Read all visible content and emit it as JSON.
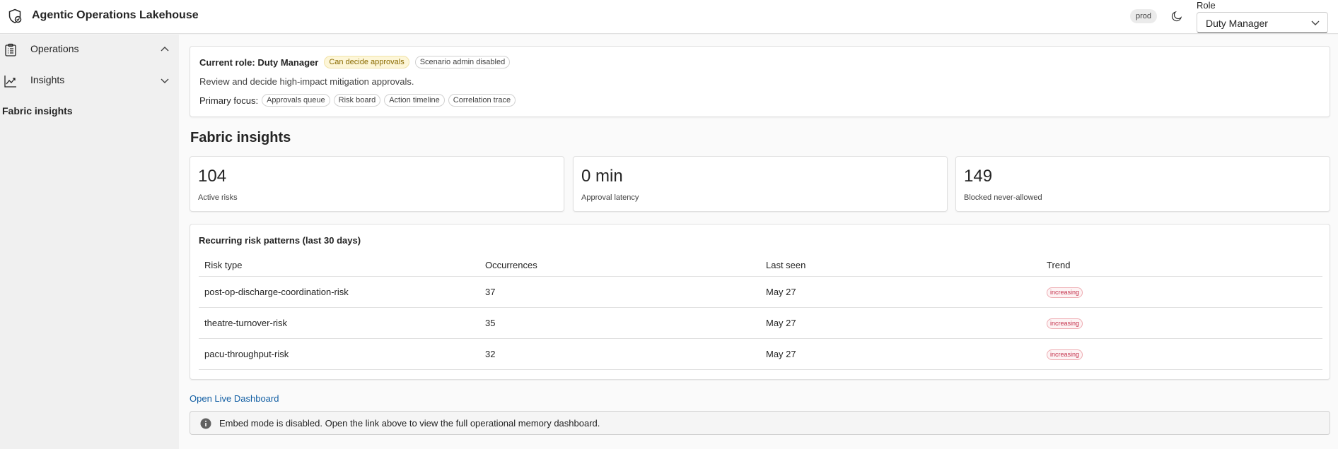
{
  "header": {
    "app_title": "Agentic Operations Lakehouse",
    "env_badge": "prod",
    "role_label": "Role",
    "role_value": "Duty Manager"
  },
  "sidebar": {
    "items": [
      {
        "label": "Operations",
        "icon": "clipboard-icon",
        "expanded": true
      },
      {
        "label": "Insights",
        "icon": "chart-line-icon",
        "expanded": false
      }
    ],
    "active_sub": "Fabric insights"
  },
  "role_card": {
    "current_role": "Current role: Duty Manager",
    "chips": [
      "Can decide approvals",
      "Scenario admin disabled"
    ],
    "description": "Review and decide high-impact mitigation approvals.",
    "focus_label": "Primary focus:",
    "focus_chips": [
      "Approvals queue",
      "Risk board",
      "Action timeline",
      "Correlation trace"
    ]
  },
  "page_title": "Fabric insights",
  "kpis": [
    {
      "value": "104",
      "label": "Active risks"
    },
    {
      "value": "0 min",
      "label": "Approval latency"
    },
    {
      "value": "149",
      "label": "Blocked never-allowed"
    }
  ],
  "patterns": {
    "title": "Recurring risk patterns (last 30 days)",
    "columns": [
      "Risk type",
      "Occurrences",
      "Last seen",
      "Trend"
    ],
    "rows": [
      {
        "risk": "post-op-discharge-coordination-risk",
        "occurrences": "37",
        "last_seen": "May 27",
        "trend": "increasing"
      },
      {
        "risk": "theatre-turnover-risk",
        "occurrences": "35",
        "last_seen": "May 27",
        "trend": "increasing"
      },
      {
        "risk": "pacu-throughput-risk",
        "occurrences": "32",
        "last_seen": "May 27",
        "trend": "increasing"
      }
    ]
  },
  "dashboard_link": "Open Live Dashboard",
  "info_message": "Embed mode is disabled. Open the link above to view the full operational memory dashboard.",
  "colors": {
    "accent_link": "#115ea3",
    "trend_danger": "#c4314b",
    "chip_gold": "#8a6a00"
  }
}
